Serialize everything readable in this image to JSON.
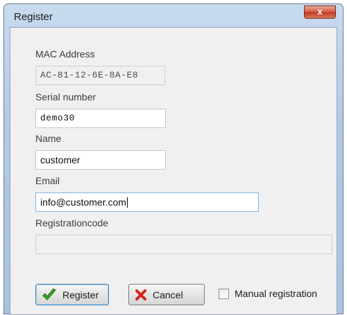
{
  "window": {
    "title": "Register",
    "close_glyph": "x"
  },
  "form": {
    "mac_label": "MAC Address",
    "mac_value": "AC-81-12-6E-8A-E8",
    "serial_label": "Serial number",
    "serial_value": "demo30",
    "name_label": "Name",
    "name_value": "customer",
    "email_label": "Email",
    "email_value": "info@customer.com",
    "regcode_label": "Registrationcode",
    "regcode_value": ""
  },
  "buttons": {
    "register_label": "Register",
    "register_icon": "green-checkmark-icon",
    "cancel_label": "Cancel",
    "cancel_icon": "red-x-icon"
  },
  "manual": {
    "label": "Manual registration",
    "checked": false
  },
  "colors": {
    "check_green": "#3aa523",
    "cancel_red": "#d2231c",
    "titlebar": "#b8cde6"
  }
}
